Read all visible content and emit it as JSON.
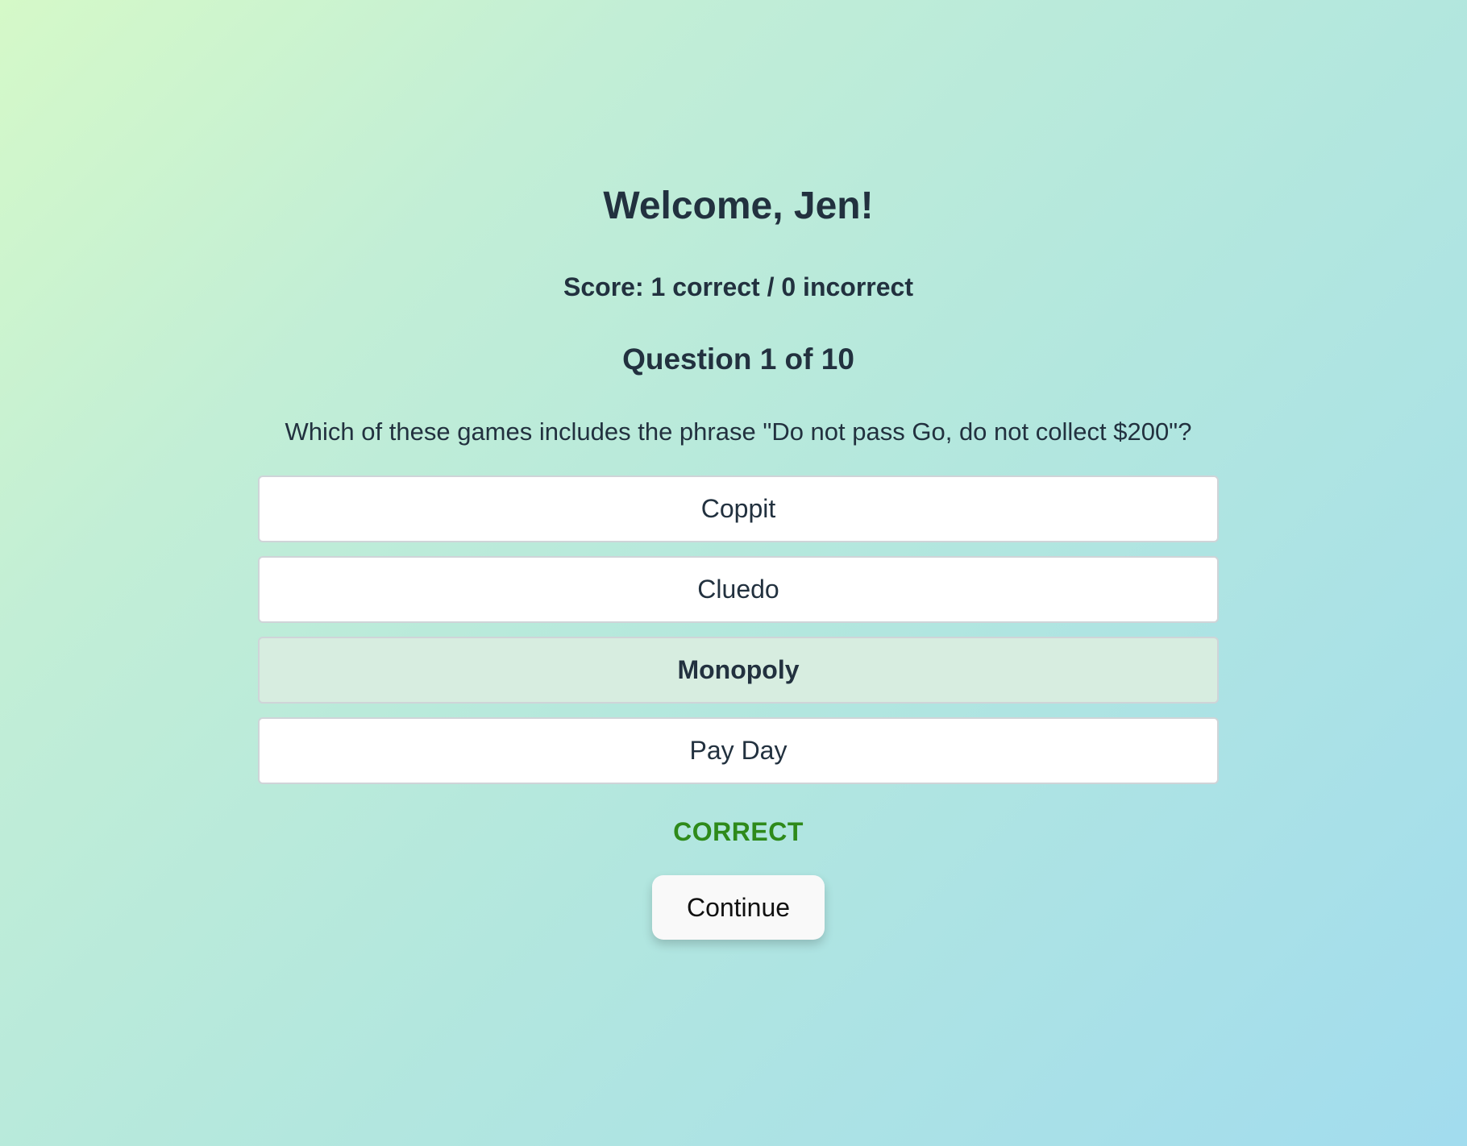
{
  "header": {
    "welcome": "Welcome, Jen!",
    "score": "Score: 1 correct / 0 incorrect"
  },
  "question": {
    "counter": "Question 1 of 10",
    "text": "Which of these games includes the phrase \"Do not pass Go, do not collect $200\"?",
    "options": [
      {
        "label": "Coppit",
        "selected": false
      },
      {
        "label": "Cluedo",
        "selected": false
      },
      {
        "label": "Monopoly",
        "selected": true
      },
      {
        "label": "Pay Day",
        "selected": false
      }
    ]
  },
  "feedback": {
    "result": "CORRECT",
    "result_color": "#2e8a1a",
    "selected_option_color": "#d7ede0"
  },
  "actions": {
    "continue_label": "Continue"
  }
}
